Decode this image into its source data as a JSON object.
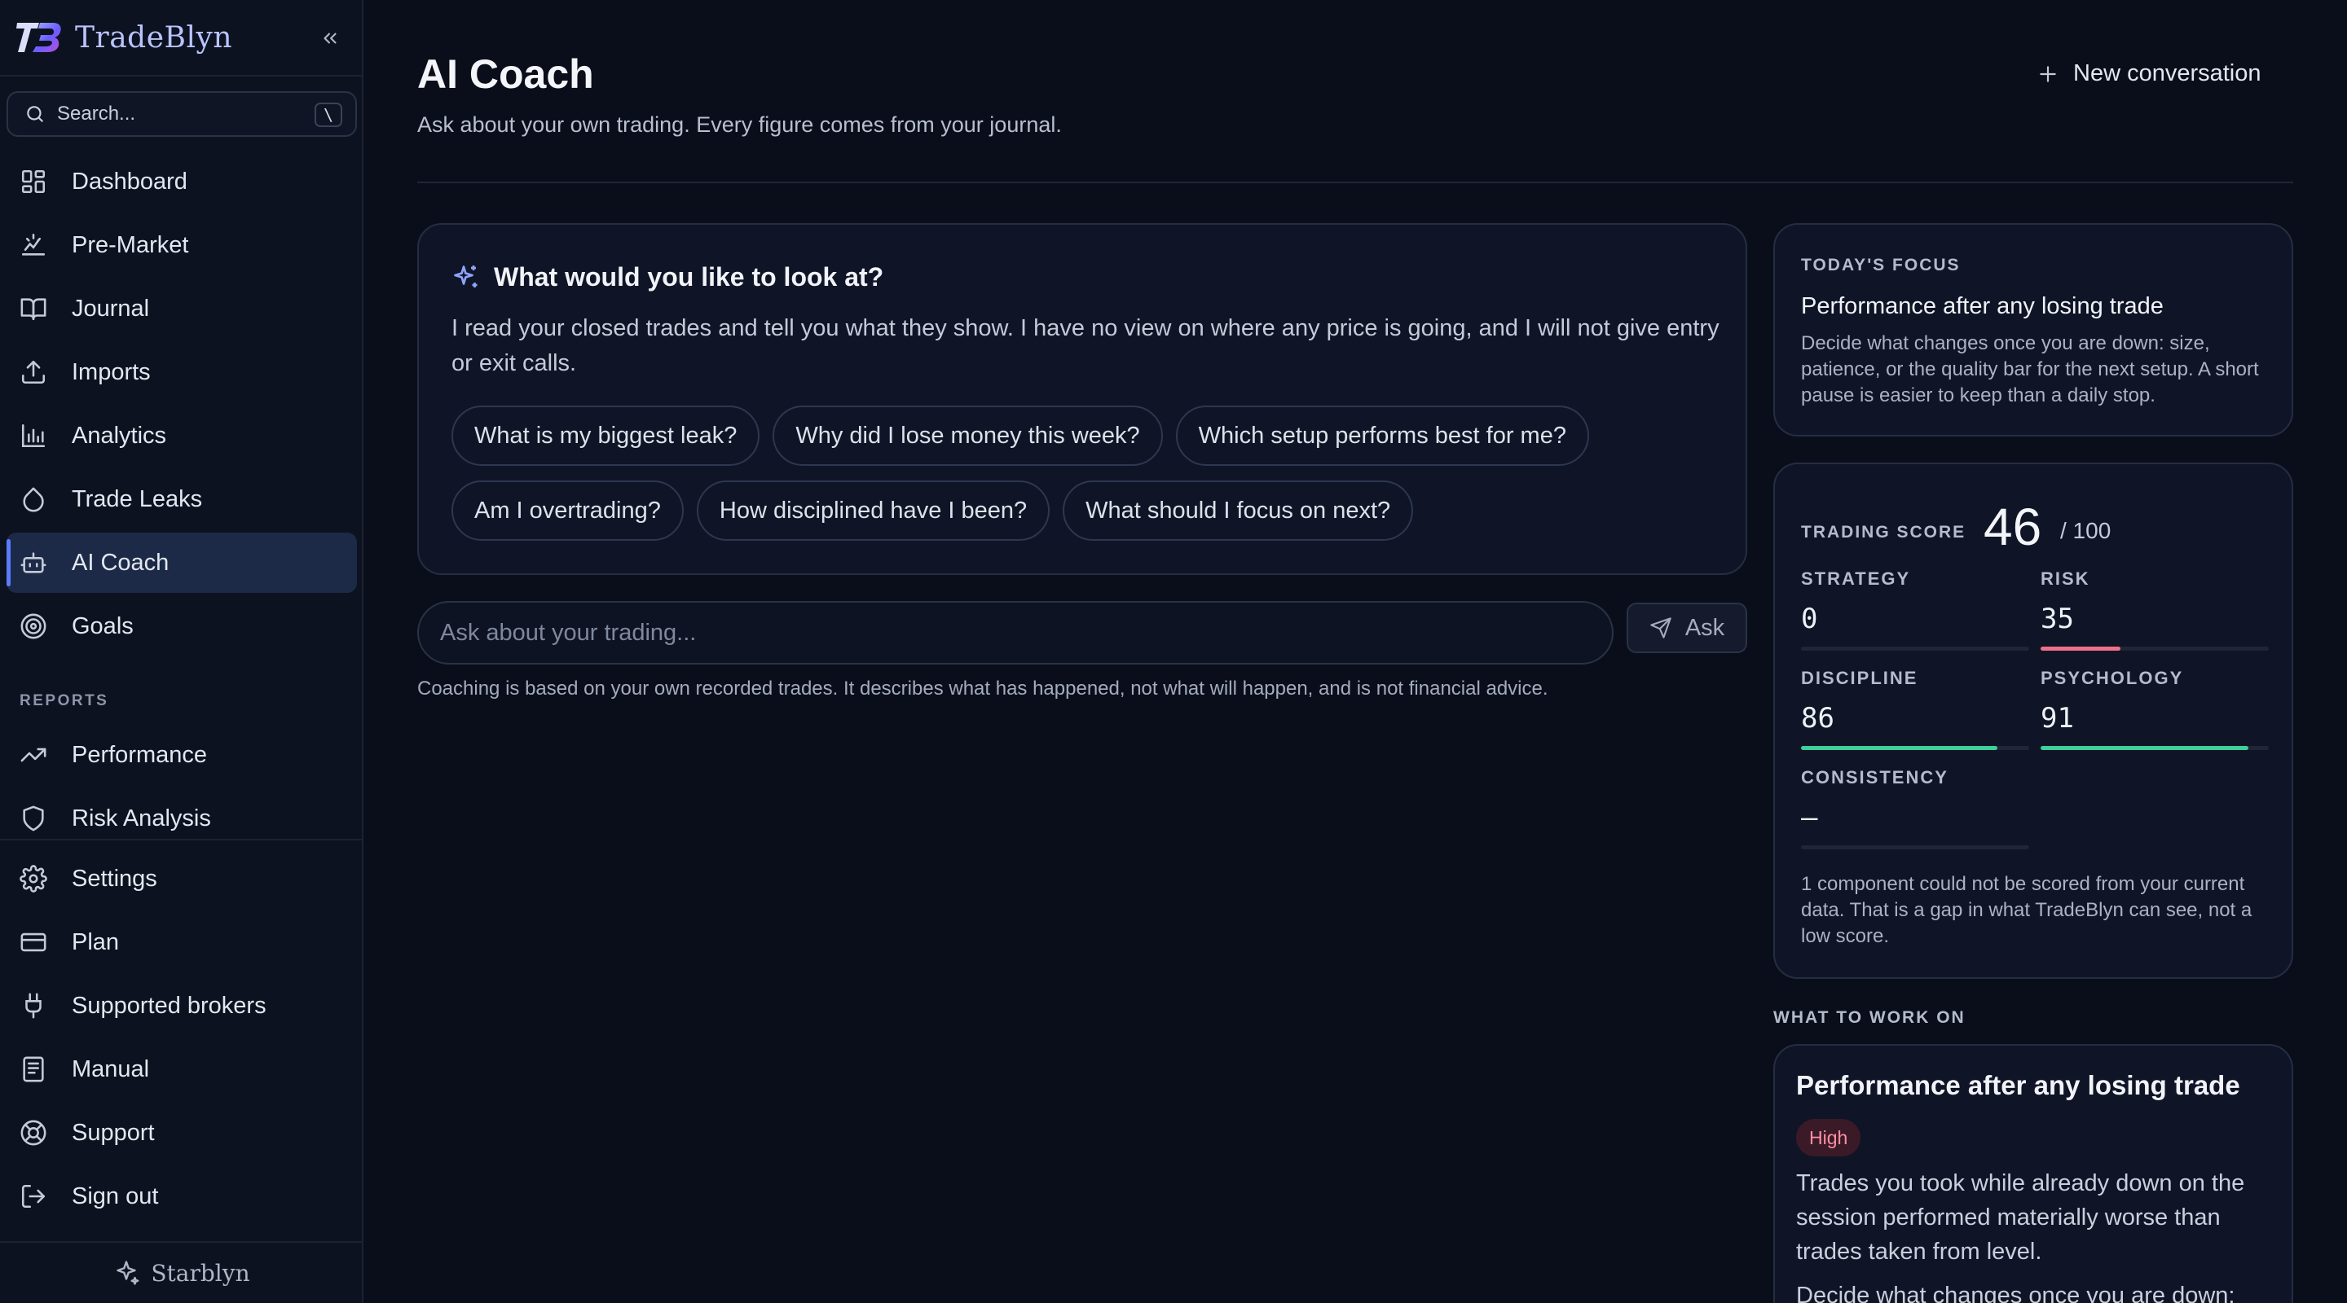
{
  "brand": {
    "name": "TradeBlyn",
    "footer": "Starblyn"
  },
  "search": {
    "placeholder": "Search...",
    "shortcut": "\\"
  },
  "sidebar": {
    "items": [
      {
        "label": "Dashboard",
        "icon": "dashboard-icon"
      },
      {
        "label": "Pre-Market",
        "icon": "pre-market-icon"
      },
      {
        "label": "Journal",
        "icon": "book-icon"
      },
      {
        "label": "Imports",
        "icon": "upload-icon"
      },
      {
        "label": "Analytics",
        "icon": "bar-chart-icon"
      },
      {
        "label": "Trade Leaks",
        "icon": "droplet-icon"
      },
      {
        "label": "AI Coach",
        "icon": "bot-icon",
        "active": true
      },
      {
        "label": "Goals",
        "icon": "target-icon"
      }
    ],
    "reports_label": "REPORTS",
    "reports": [
      {
        "label": "Performance",
        "icon": "trending-up-icon"
      },
      {
        "label": "Risk Analysis",
        "icon": "shield-icon"
      }
    ],
    "bottom": [
      {
        "label": "Settings",
        "icon": "gear-icon"
      },
      {
        "label": "Plan",
        "icon": "credit-card-icon"
      },
      {
        "label": "Supported brokers",
        "icon": "plug-icon"
      },
      {
        "label": "Manual",
        "icon": "manual-icon"
      },
      {
        "label": "Support",
        "icon": "lifebuoy-icon"
      },
      {
        "label": "Sign out",
        "icon": "sign-out-icon"
      }
    ]
  },
  "header": {
    "title": "AI Coach",
    "subtitle": "Ask about your own trading. Every figure comes from your journal.",
    "new_conversation": "New conversation"
  },
  "prompt_card": {
    "title": "What would you like to look at?",
    "body": "I read your closed trades and tell you what they show. I have no view on where any price is going, and I will not give entry or exit calls.",
    "suggestions": [
      "What is my biggest leak?",
      "Why did I lose money this week?",
      "Which setup performs best for me?",
      "Am I overtrading?",
      "How disciplined have I been?",
      "What should I focus on next?"
    ]
  },
  "ask": {
    "placeholder": "Ask about your trading...",
    "button": "Ask",
    "disclaimer": "Coaching is based on your own recorded trades. It describes what has happened, not what will happen, and is not financial advice."
  },
  "focus": {
    "eyebrow": "TODAY'S FOCUS",
    "title": "Performance after any losing trade",
    "description": "Decide what changes once you are down: size, patience, or the quality bar for the next setup. A short pause is easier to keep than a daily stop."
  },
  "score": {
    "label": "TRADING SCORE",
    "value": "46",
    "max": "/ 100",
    "metrics": [
      {
        "label": "STRATEGY",
        "value": "0",
        "fill": 0,
        "color": "#2a3246"
      },
      {
        "label": "RISK",
        "value": "35",
        "fill": 0.35,
        "color": "#f0708a"
      },
      {
        "label": "DISCIPLINE",
        "value": "86",
        "fill": 0.86,
        "color": "#3ecf9b"
      },
      {
        "label": "PSYCHOLOGY",
        "value": "91",
        "fill": 0.91,
        "color": "#3ecf9b"
      },
      {
        "label": "CONSISTENCY",
        "value": "—",
        "fill": 0,
        "color": "#2a3246"
      }
    ],
    "note": "1 component could not be scored from your current data. That is a gap in what TradeBlyn can see, not a low score."
  },
  "work_on": {
    "label": "WHAT TO WORK ON",
    "title": "Performance after any losing trade",
    "badge": "High",
    "body": "Trades you took while already down on the session performed materially worse than trades taken from level.",
    "body2": "Decide what changes once you are down:"
  },
  "colors": {
    "accent": "#5b7cff",
    "background": "#0a0e1a",
    "card": "#0f1526"
  }
}
